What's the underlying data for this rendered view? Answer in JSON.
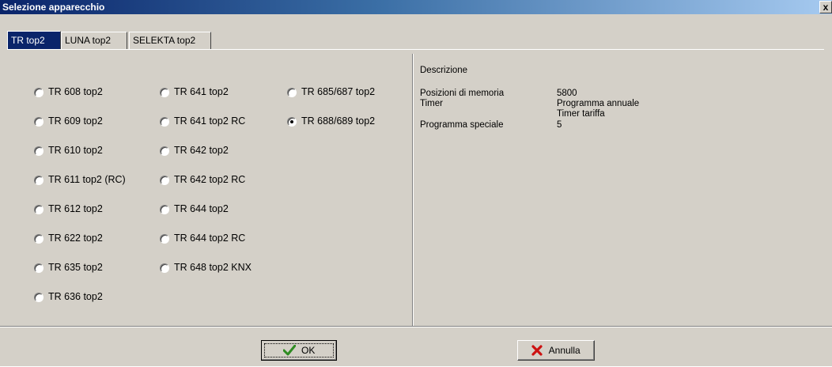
{
  "window": {
    "title": "Selezione apparecchio",
    "close_label": "x"
  },
  "tabs": [
    {
      "label": "TR top2",
      "active": true
    },
    {
      "label": "LUNA top2",
      "active": false
    },
    {
      "label": "SELEKTA top2",
      "active": false
    }
  ],
  "devices": {
    "col1": [
      "TR 608 top2",
      "TR 609 top2",
      "TR 610 top2",
      "TR 611 top2 (RC)",
      "TR 612 top2",
      "TR 622 top2",
      "TR 635 top2",
      "TR 636 top2"
    ],
    "col2": [
      "TR 641 top2",
      "TR 641 top2 RC",
      "TR 642 top2",
      "TR 642 top2 RC",
      "TR 644 top2",
      "TR 644 top2 RC",
      "TR 648 top2 KNX"
    ],
    "col3": [
      "TR 685/687 top2",
      "TR 688/689 top2"
    ],
    "selected": "TR 688/689 top2"
  },
  "description": {
    "title": "Descrizione",
    "rows": [
      {
        "label": "Posizioni di memoria",
        "values": [
          "5800"
        ]
      },
      {
        "label": "Timer",
        "values": [
          "Programma annuale",
          "Timer tariffa"
        ]
      },
      {
        "label": "Programma speciale",
        "values": [
          "5"
        ]
      }
    ]
  },
  "buttons": {
    "ok_label": "OK",
    "cancel_label": "Annulla",
    "ok_icon": "checkmark-icon",
    "cancel_icon": "red-x-icon",
    "ok_icon_color": "#2e8b22",
    "cancel_icon_color": "#cc1111"
  }
}
